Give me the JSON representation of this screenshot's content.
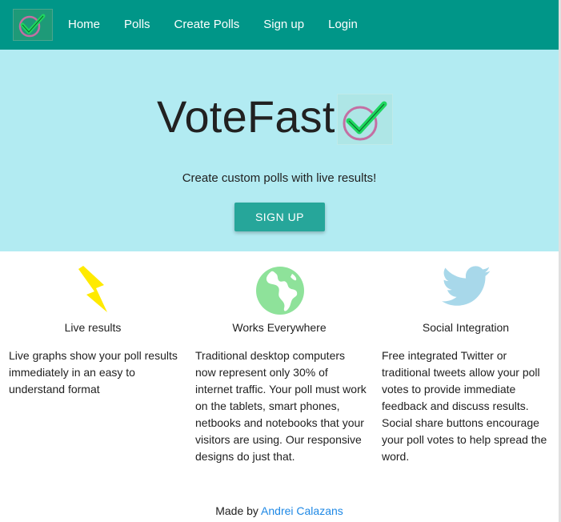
{
  "nav": {
    "logo_icon": "checkmark-circle-icon",
    "links": [
      "Home",
      "Polls",
      "Create Polls",
      "Sign up",
      "Login"
    ]
  },
  "hero": {
    "title": "VoteFast",
    "logo_icon": "checkmark-circle-icon",
    "tagline": "Create custom polls with live results!",
    "button": "SIGN UP"
  },
  "features": [
    {
      "icon": "lightning-bolt-icon",
      "title": "Live results",
      "text": "Live graphs show your poll results immediately in an easy to understand format"
    },
    {
      "icon": "globe-icon",
      "title": "Works Everywhere",
      "text": "Traditional desktop computers now represent only 30% of internet traffic. Your poll must work on the tablets, smart phones, netbooks and notebooks that your visitors are using. Our responsive designs do just that."
    },
    {
      "icon": "twitter-bird-icon",
      "title": "Social Integration",
      "text": "Free integrated Twitter or traditional tweets allow your poll votes to provide immediate feedback and discuss results. Social share buttons encourage your poll votes to help spread the word."
    }
  ],
  "footer": {
    "prefix": "Made by",
    "author": "Andrei Calazans"
  },
  "colors": {
    "nav": "#009688",
    "hero": "#b2ebf2",
    "button": "#26a69a",
    "link": "#1e88e5"
  }
}
